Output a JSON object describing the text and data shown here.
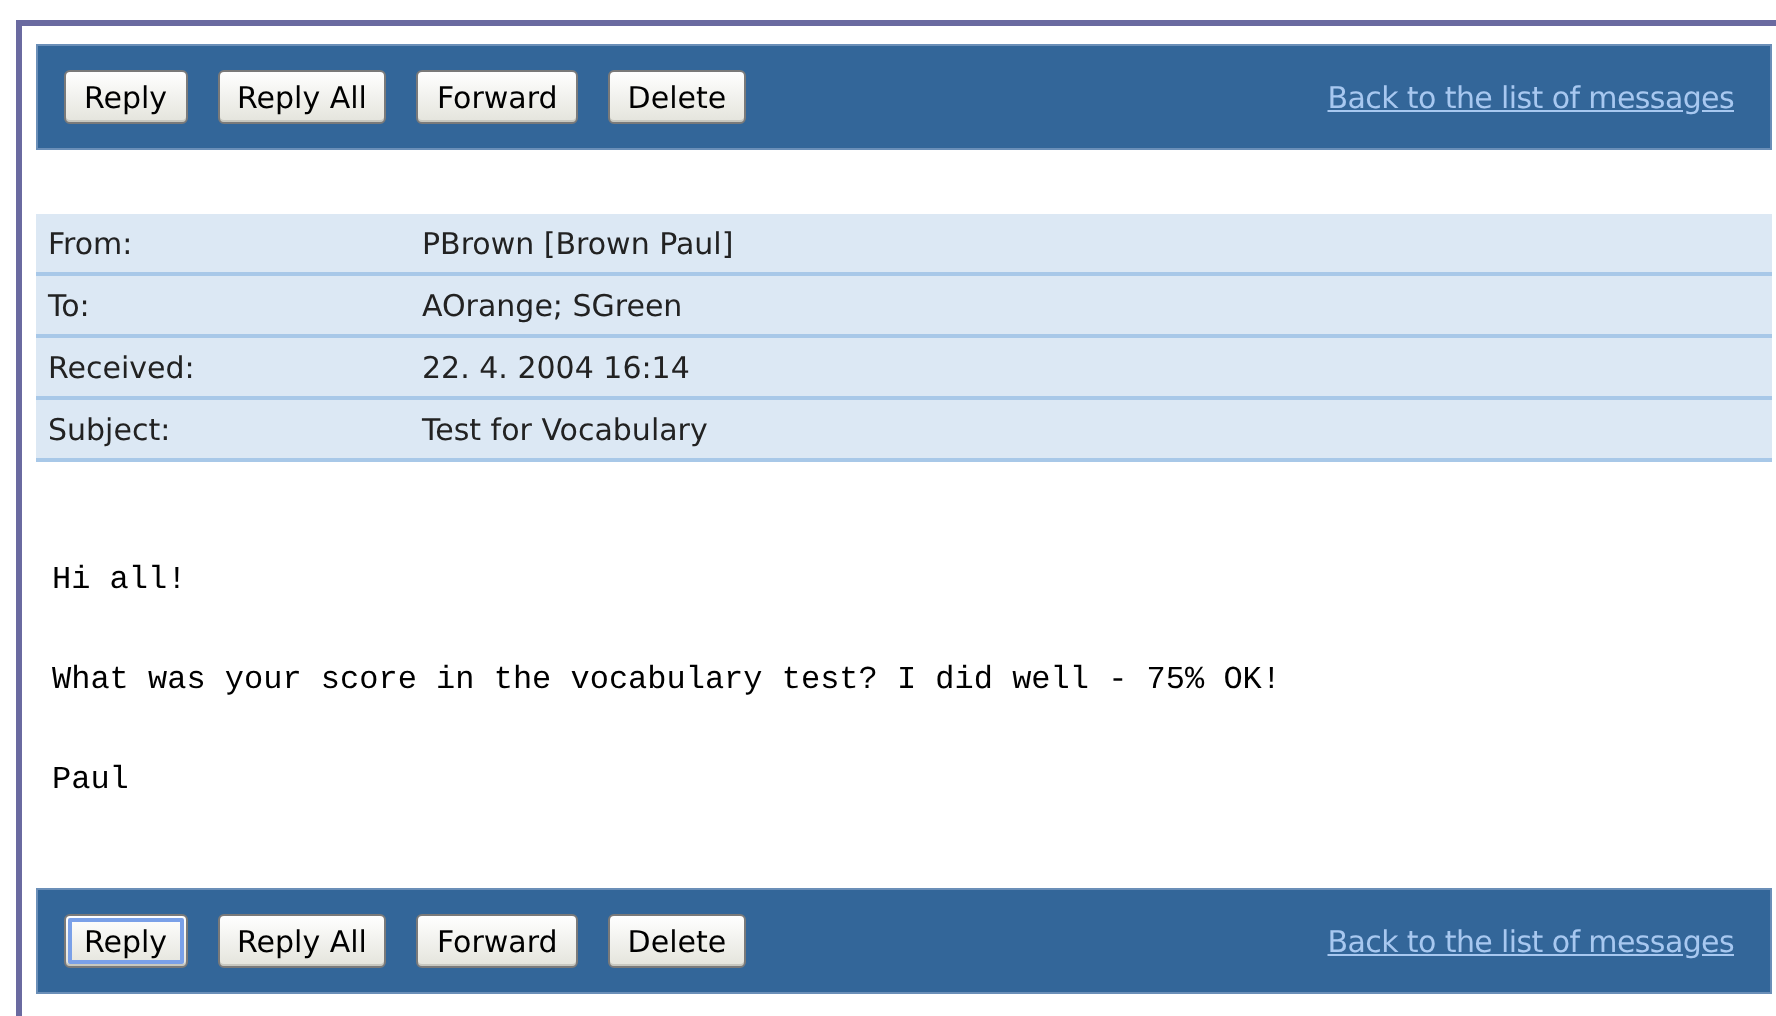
{
  "top_toolbar": {
    "buttons": [
      {
        "label": "Reply",
        "focused": false
      },
      {
        "label": "Reply All",
        "focused": false
      },
      {
        "label": "Forward",
        "focused": false
      },
      {
        "label": "Delete",
        "focused": false
      }
    ],
    "link": "Back to the list of messages"
  },
  "headers": [
    {
      "label": "From:",
      "value": "PBrown [Brown Paul]"
    },
    {
      "label": "To:",
      "value": "AOrange; SGreen"
    },
    {
      "label": "Received:",
      "value": "22. 4. 2004 16:14"
    },
    {
      "label": "Subject:",
      "value": "Test for Vocabulary"
    }
  ],
  "body": [
    "Hi all!",
    "What was your score in the vocabulary test? I did well - 75% OK!",
    "Paul"
  ],
  "bottom_toolbar": {
    "buttons": [
      {
        "label": "Reply",
        "focused": true
      },
      {
        "label": "Reply All",
        "focused": false
      },
      {
        "label": "Forward",
        "focused": false
      },
      {
        "label": "Delete",
        "focused": false
      }
    ],
    "link": "Back to the list of messages"
  }
}
